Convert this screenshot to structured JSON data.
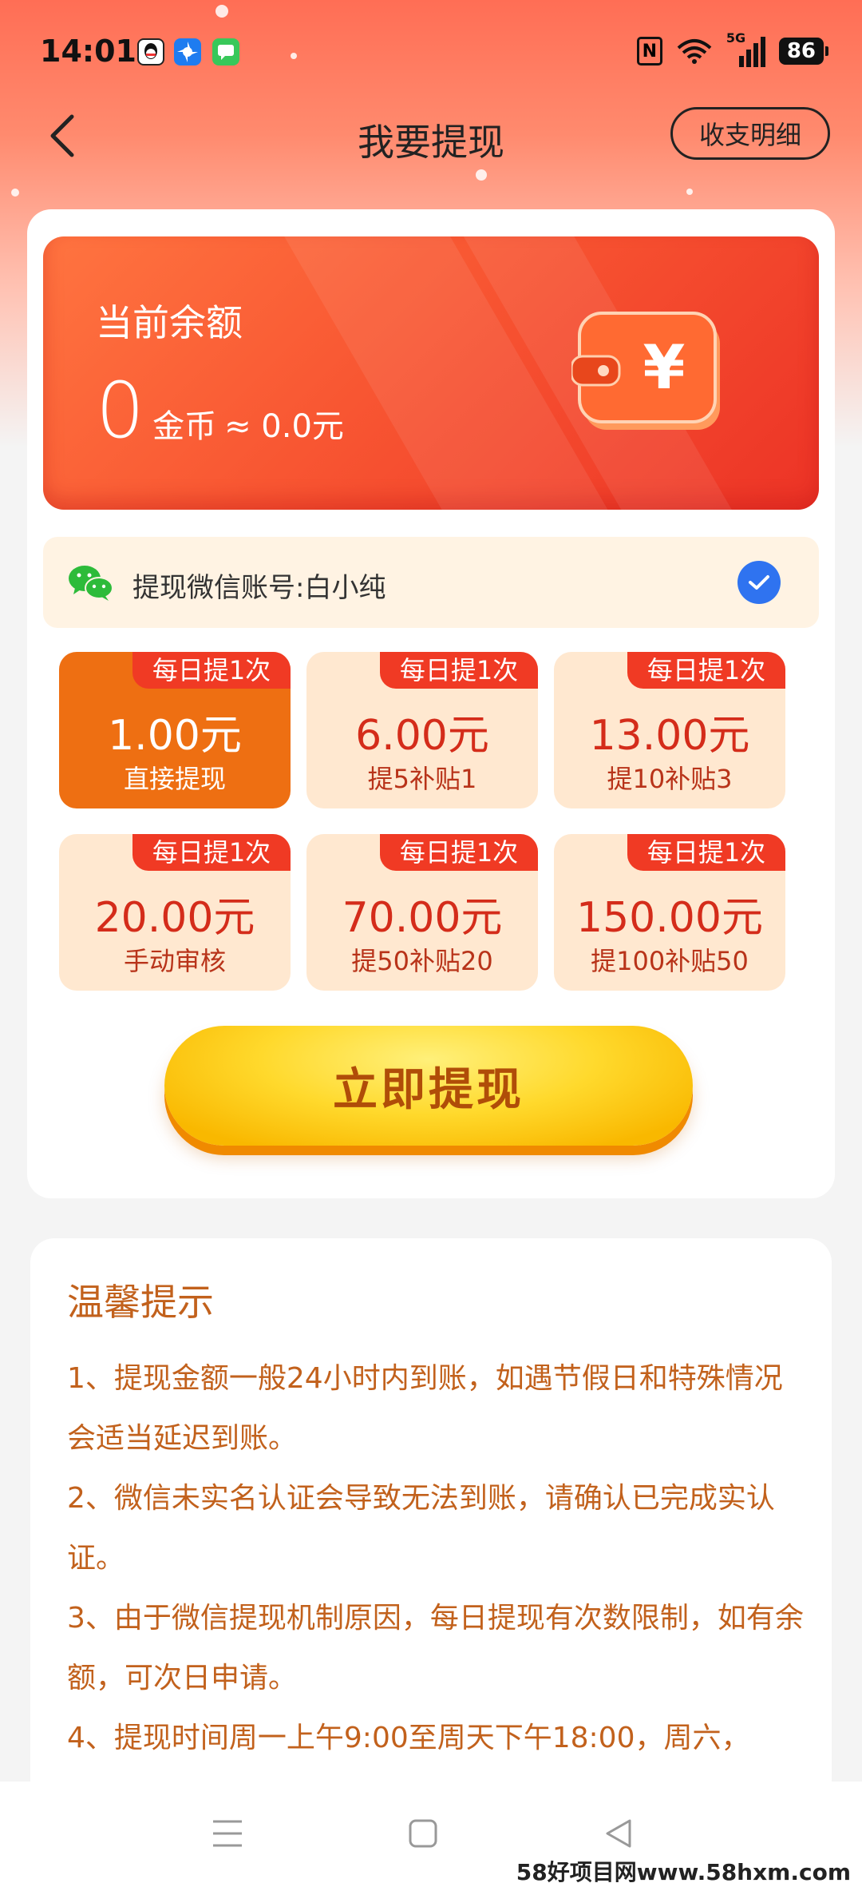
{
  "status_bar": {
    "time": "14:01",
    "network": "5G",
    "battery": "86"
  },
  "header": {
    "title": "我要提现",
    "detail_button": "收支明细"
  },
  "balance": {
    "label": "当前余额",
    "amount": "0",
    "unit": "金币",
    "approx": "≈ 0.0元"
  },
  "wechat": {
    "label": "提现微信账号:白小纯",
    "checked": true
  },
  "options": [
    {
      "badge": "每日提1次",
      "amount": "1.00元",
      "sub": "直接提现",
      "active": true
    },
    {
      "badge": "每日提1次",
      "amount": "6.00元",
      "sub": "提5补贴1",
      "active": false
    },
    {
      "badge": "每日提1次",
      "amount": "13.00元",
      "sub": "提10补贴3",
      "active": false
    },
    {
      "badge": "每日提1次",
      "amount": "20.00元",
      "sub": "手动审核",
      "active": false
    },
    {
      "badge": "每日提1次",
      "amount": "70.00元",
      "sub": "提50补贴20",
      "active": false
    },
    {
      "badge": "每日提1次",
      "amount": "150.00元",
      "sub": "提100补贴50",
      "active": false
    }
  ],
  "withdraw_button": "立即提现",
  "tips": {
    "title": "温馨提示",
    "items": [
      "1、提现金额一般24小时内到账，如遇节假日和特殊情况会适当延迟到账。",
      "2、微信未实名认证会导致无法到账，请确认已完成实认证。",
      "3、由于微信提现机制原因，每日提现有次数限制，如有余额，可次日申请。",
      "4、提现时间周一上午9:00至周天下午18:00，周六，"
    ]
  },
  "watermark": "58好项目网www.58hxm.com",
  "colors": {
    "accent": "#ee6f12",
    "badge": "#f03a24",
    "tip_text": "#c2611c",
    "button": "#ffd92c"
  }
}
